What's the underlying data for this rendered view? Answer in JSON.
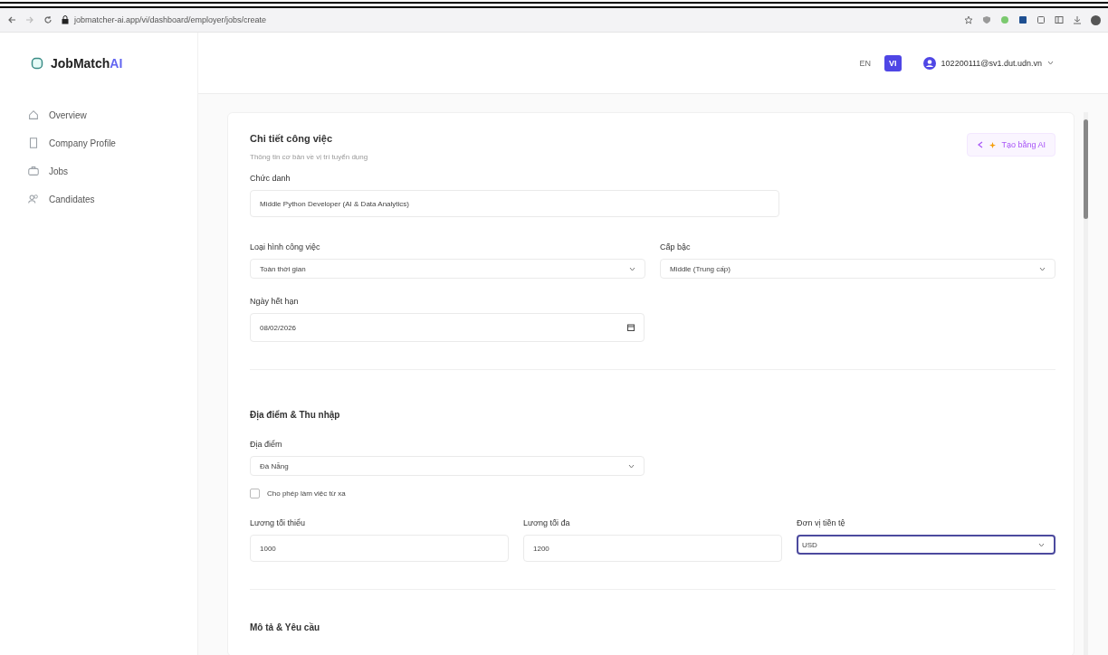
{
  "browser": {
    "url": "jobmatcher-ai.app/vi/dashboard/employer/jobs/create"
  },
  "logo": {
    "name": "JobMatch",
    "accent": "AI"
  },
  "sidebar": {
    "items": [
      {
        "label": "Overview",
        "selected": false
      },
      {
        "label": "Company Profile",
        "selected": false
      },
      {
        "label": "Jobs",
        "selected": false
      },
      {
        "label": "Candidates",
        "selected": false
      }
    ]
  },
  "header": {
    "languages": [
      {
        "label": "EN",
        "selected": false
      },
      {
        "label": "VI",
        "selected": true
      }
    ],
    "user_email": "102200111@sv1.dut.udn.vn"
  },
  "form": {
    "title": "Chi tiết công việc",
    "subtitle": "Thông tin cơ bản về vị trí tuyển dụng",
    "ai_button": "Tạo bằng AI",
    "job_title": {
      "label": "Chức danh",
      "value": "Middle Python Developer (AI & Data Analytics)"
    },
    "job_type": {
      "label": "Loại hình công việc",
      "value": "Toàn thời gian"
    },
    "level": {
      "label": "Cấp bậc",
      "value": "Middle (Trung cấp)"
    },
    "deadline": {
      "label": "Ngày hết hạn",
      "value": "08/02/2026"
    },
    "location_section": "Địa điểm & Thu nhập",
    "location": {
      "label": "Địa điểm",
      "value": "Đà Nẵng"
    },
    "remote": {
      "label": "Cho phép làm việc từ xa",
      "checked": false
    },
    "salary_min": {
      "label": "Lương tối thiểu",
      "value": "1000"
    },
    "salary_max": {
      "label": "Lương tối đa",
      "value": "1200"
    },
    "currency": {
      "label": "Đơn vị tiền tệ",
      "value": "USD",
      "focused": true
    },
    "next_section": "Mô tả & Yêu cầu"
  }
}
